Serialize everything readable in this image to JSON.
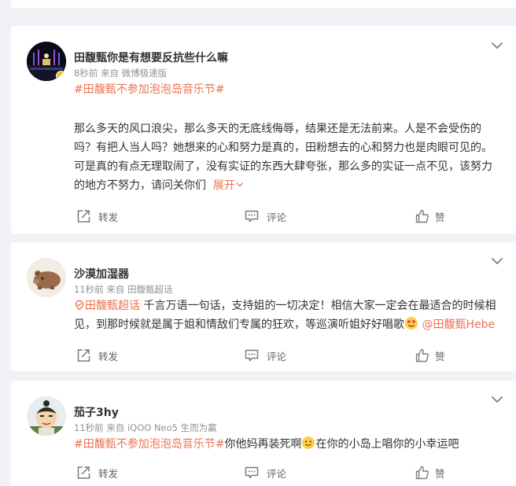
{
  "actions": {
    "share": "转发",
    "comment": "评论",
    "like": "赞"
  },
  "posts": [
    {
      "author": "田馥甄你是有想要反抗些什么嘛",
      "time": "8秒前",
      "source_prefix": "来自",
      "source": "微博极速版",
      "tag": "#田馥甄不参加泡泡岛音乐节#",
      "body": "那么多天的风口浪尖，那么多天的无底线侮辱，结果还是无法前来。人是不会受伤的吗？有把人当人吗？她想来的心和努力是真的，田粉想去的心和努力也是肉眼可见的。可是真的有点无理取闹了，没有实证的东西大肆夸张，那么多的实证一点不见，该努力的地方不努力，请问关你们",
      "expand": "展开"
    },
    {
      "author": "沙漠加湿器",
      "time": "11秒前",
      "source_prefix": "来自",
      "source": "田馥甄超话",
      "tag": "田馥甄超话",
      "body": " 千言万语一句话，支持姐的一切决定！相信大家一定会在最适合的时候相见，到那时候就是属于姐和情敌们专属的狂欢，等巡演听姐好好唱歌",
      "mention": "@田馥甄Hebe"
    },
    {
      "author": "茄子3hy",
      "time": "11秒前",
      "source_prefix": "来自",
      "source": "iQOO Neo5 生而为赢",
      "tag": "#田馥甄不参加泡泡岛音乐节#",
      "body_a": "你他妈再装死啊",
      "body_b": "在你的小岛上唱你的小幸运吧"
    }
  ],
  "colors": {
    "accent": "#ff8200",
    "link": "#eb7350",
    "verified": "#ffc000"
  }
}
